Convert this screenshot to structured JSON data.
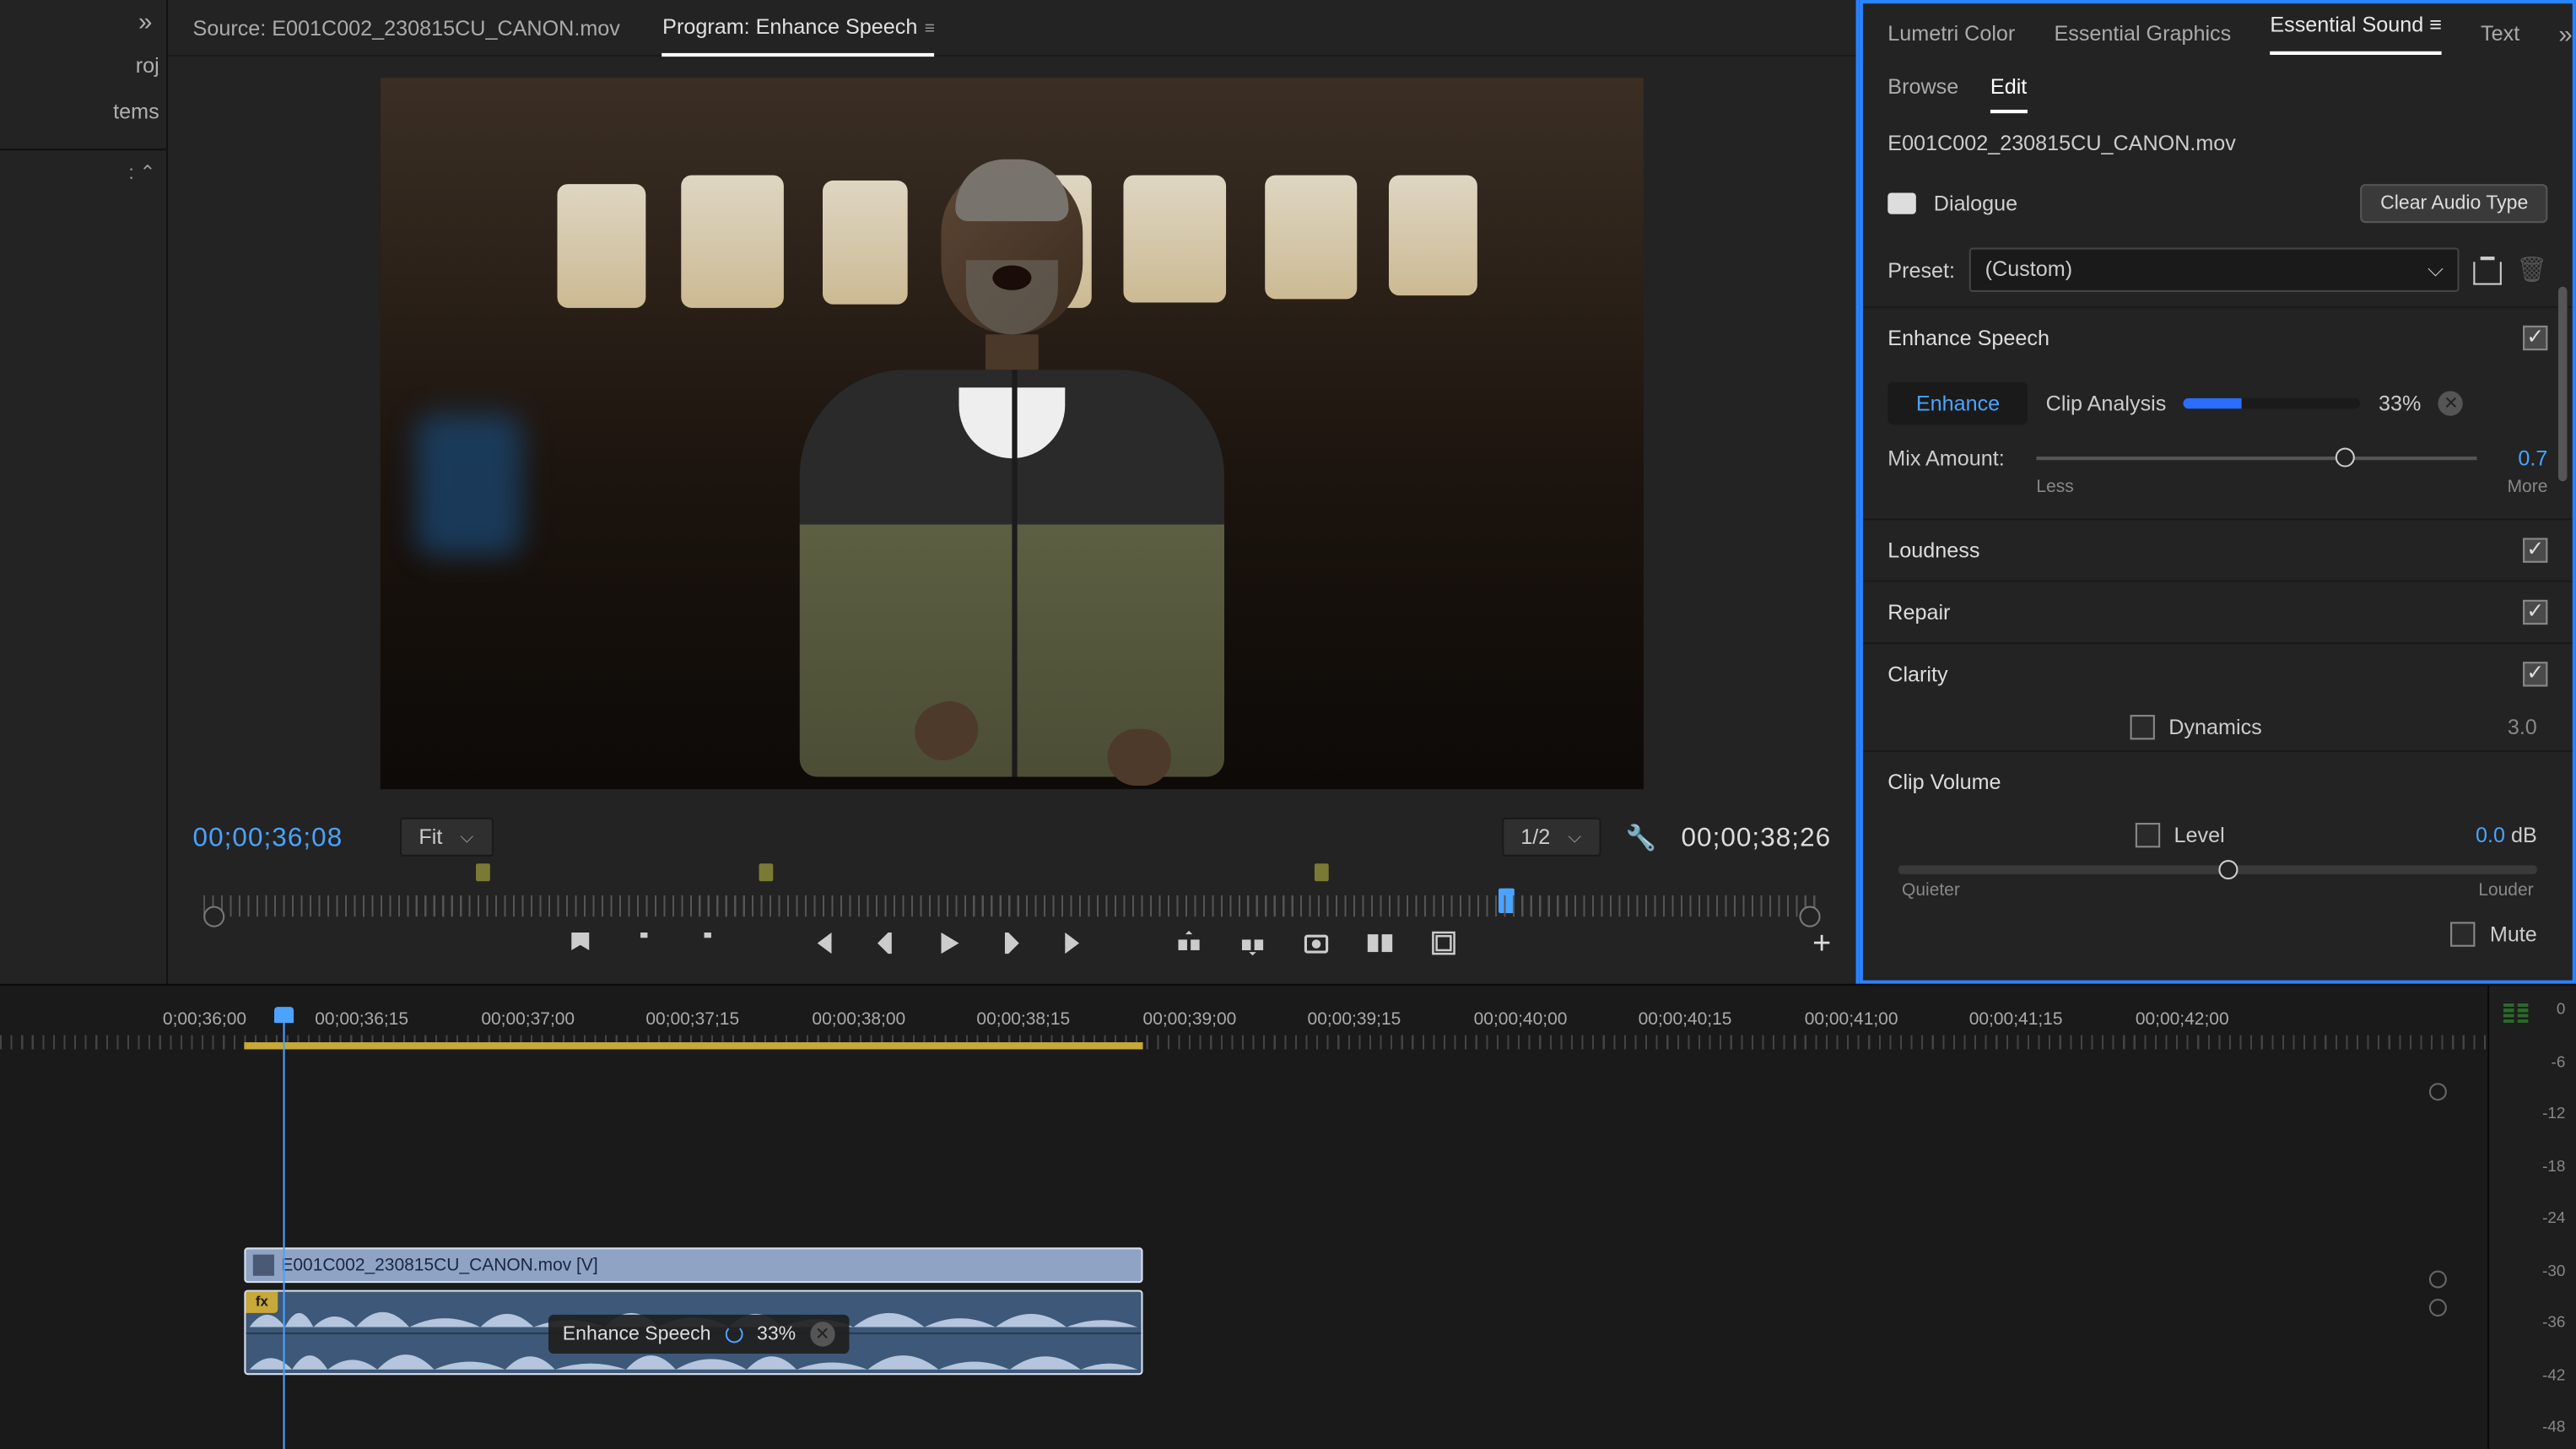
{
  "left_strip": {
    "item1": "roj",
    "item2": "tems",
    "collapse": "⌃"
  },
  "source_tab": "Source: E001C002_230815CU_CANON.mov",
  "program_tab": "Program: Enhance Speech",
  "timecode_current": "00;00;36;08",
  "fit_label": "Fit",
  "res_label": "1/2",
  "timecode_duration": "00;00;38;26",
  "right_tabs": {
    "lumetri": "Lumetri Color",
    "graphics": "Essential Graphics",
    "sound": "Essential Sound",
    "text": "Text"
  },
  "sub_tabs": {
    "browse": "Browse",
    "edit": "Edit"
  },
  "clip_name": "E001C002_230815CU_CANON.mov",
  "dialogue_label": "Dialogue",
  "clear_audio": "Clear Audio Type",
  "preset_label": "Preset:",
  "preset_value": "(Custom)",
  "enhance": {
    "section": "Enhance Speech",
    "btn": "Enhance",
    "analysis": "Clip Analysis",
    "pct": "33%",
    "mix_label": "Mix Amount:",
    "mix_val": "0.7",
    "less": "Less",
    "more": "More"
  },
  "loudness": "Loudness",
  "repair": "Repair",
  "clarity": "Clarity",
  "dynamics": {
    "label": "Dynamics",
    "val": "3.0"
  },
  "clip_volume": "Clip Volume",
  "level": {
    "label": "Level",
    "val": "0.0",
    "unit": "dB",
    "quieter": "Quieter",
    "louder": "Louder"
  },
  "mute": "Mute",
  "timeline": {
    "ticks": [
      "0;00;36;00",
      "00;00;36;15",
      "00;00;37;00",
      "00;00;37;15",
      "00;00;38;00",
      "00;00;38;15",
      "00;00;39;00",
      "00;00;39;15",
      "00;00;40;00",
      "00;00;40;15",
      "00;00;41;00",
      "00;00;41;15",
      "00;00;42;00"
    ],
    "vclip": "E001C002_230815CU_CANON.mov [V]",
    "fx": "fx",
    "badge_label": "Enhance Speech",
    "badge_pct": "33%"
  },
  "meter_scale": [
    "0",
    "-6",
    "-12",
    "-18",
    "-24",
    "-30",
    "-36",
    "-42",
    "-48"
  ]
}
